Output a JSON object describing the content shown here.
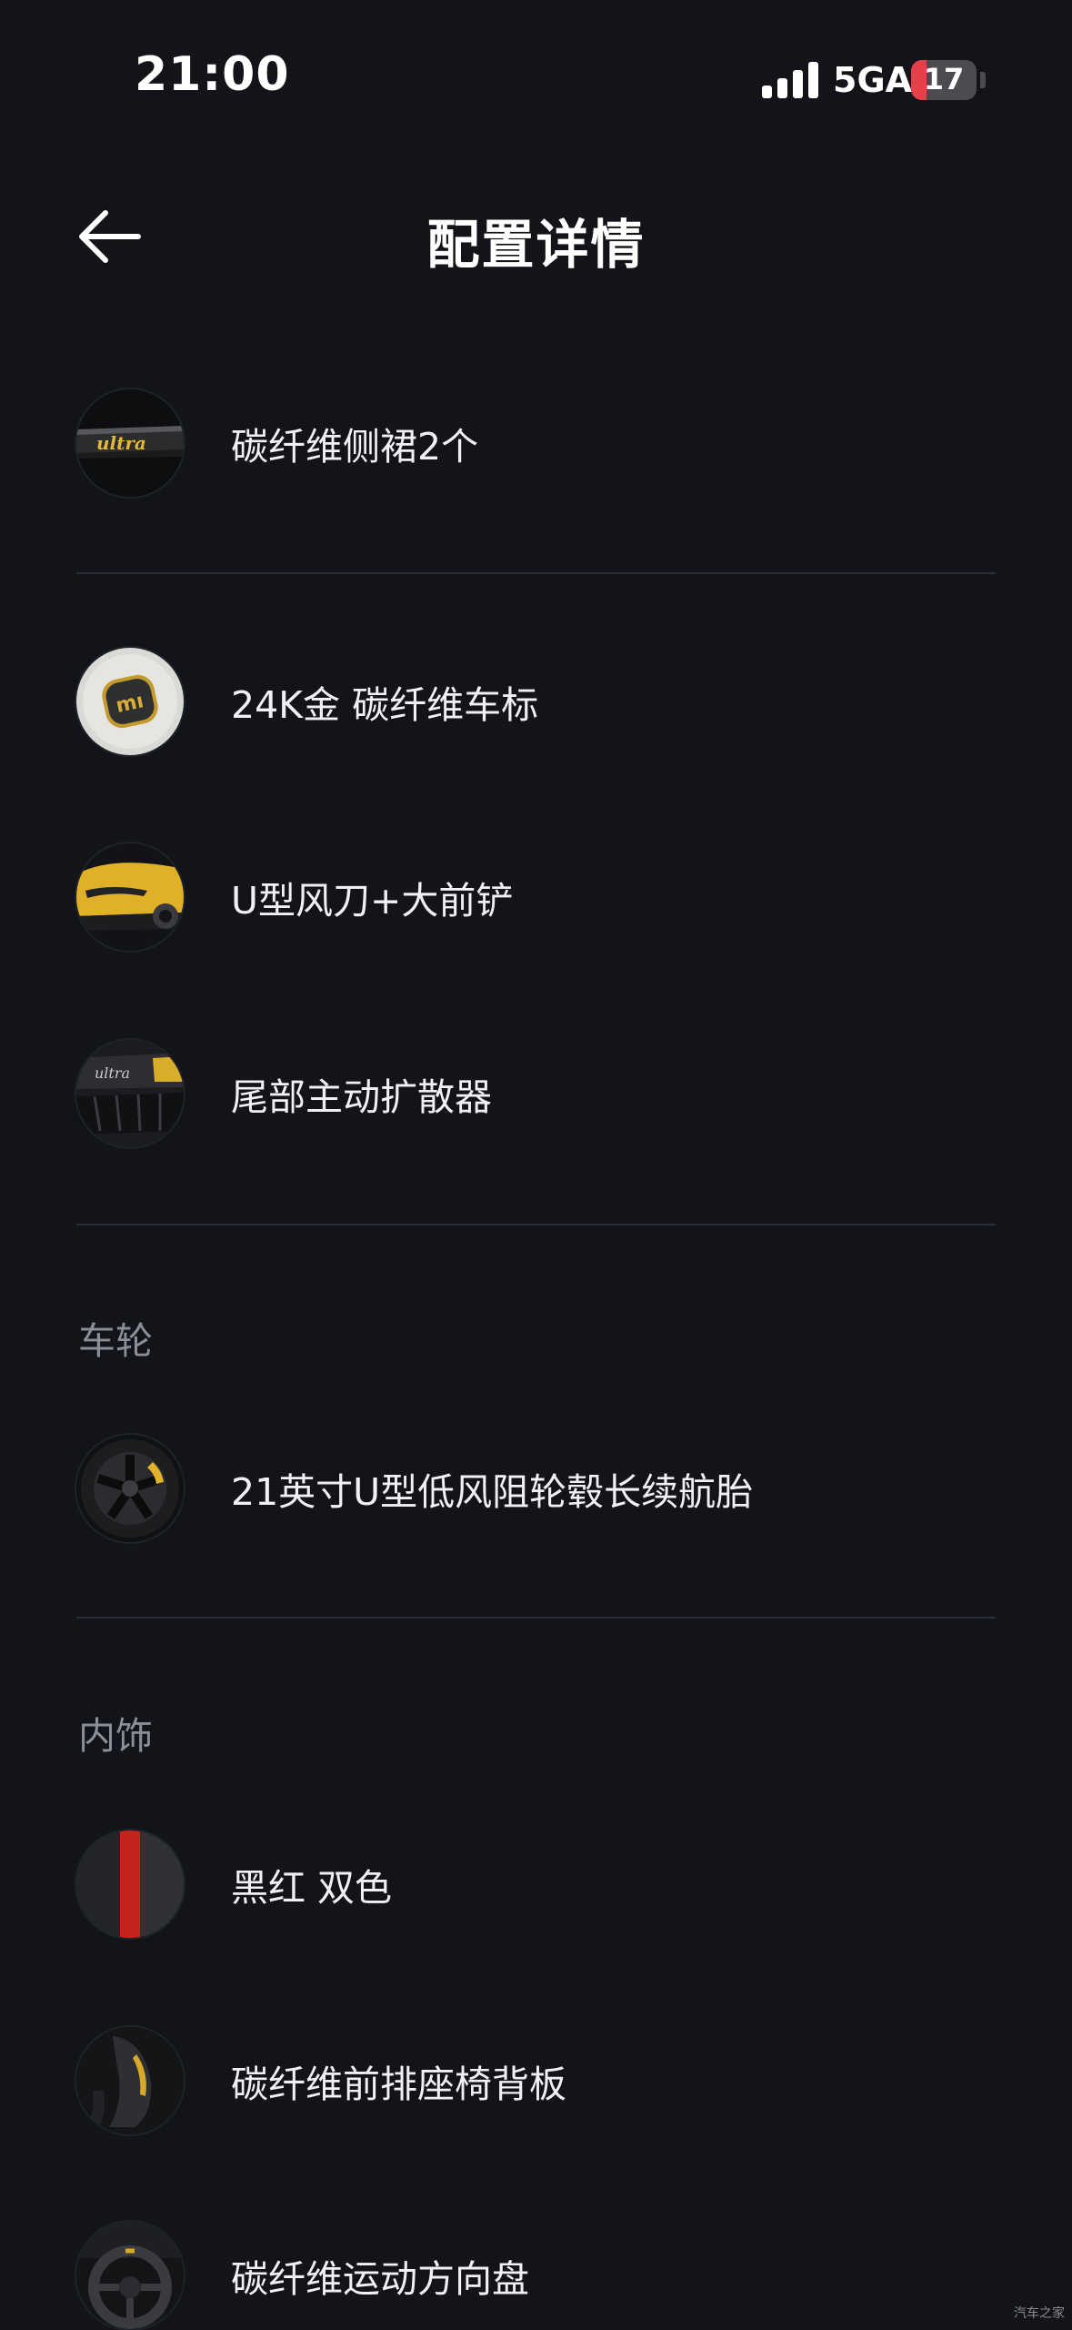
{
  "status_bar": {
    "time": "21:00",
    "network": "5GA",
    "battery_level": 17,
    "battery_text": "17",
    "battery_color": "#e8404a"
  },
  "header": {
    "back_icon": "arrow-left-icon",
    "title": "配置详情"
  },
  "sections": {
    "exterior": {
      "items": [
        {
          "icon": "carbon-side-skirt-thumbnail",
          "label": "碳纤维侧裙2个"
        },
        {
          "icon": "gold-badge-thumbnail",
          "label": "24K金 碳纤维车标"
        },
        {
          "icon": "front-spoiler-thumbnail",
          "label": "U型风刀+大前铲"
        },
        {
          "icon": "rear-diffuser-thumbnail",
          "label": "尾部主动扩散器"
        }
      ]
    },
    "wheels": {
      "heading": "车轮",
      "items": [
        {
          "icon": "wheel-thumbnail",
          "label": "21英寸U型低风阻轮毂长续航胎"
        }
      ]
    },
    "interior": {
      "heading": "内饰",
      "items": [
        {
          "icon": "black-red-trim-thumbnail",
          "label": "黑红 双色"
        },
        {
          "icon": "seat-back-thumbnail",
          "label": "碳纤维前排座椅背板"
        },
        {
          "icon": "steering-wheel-thumbnail",
          "label": "碳纤维运动方向盘"
        }
      ]
    }
  },
  "watermark": "汽车之家"
}
